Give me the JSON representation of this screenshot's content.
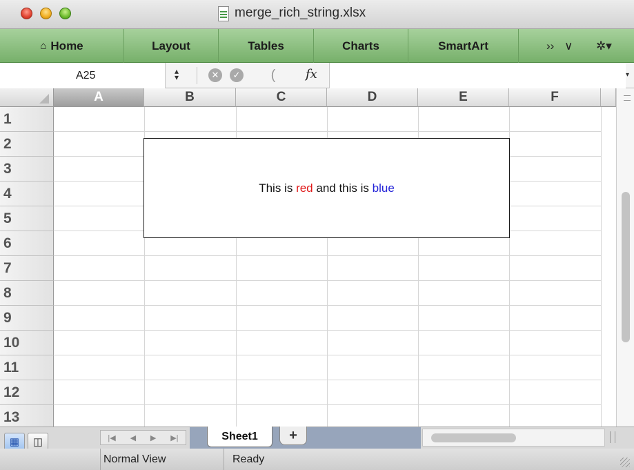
{
  "window": {
    "title": "merge_rich_string.xlsx"
  },
  "ribbon": {
    "tabs": [
      "Home",
      "Layout",
      "Tables",
      "Charts",
      "SmartArt"
    ],
    "more": "››",
    "collapse": "∨",
    "settings": "✲▾"
  },
  "formula_bar": {
    "name_box": "A25",
    "fx_label": "fx",
    "value": ""
  },
  "grid": {
    "columns": [
      "A",
      "B",
      "C",
      "D",
      "E",
      "F"
    ],
    "selected_column": "A",
    "rows": [
      "1",
      "2",
      "3",
      "4",
      "5",
      "6",
      "7",
      "8",
      "9",
      "10",
      "11",
      "12",
      "13"
    ]
  },
  "textbox": {
    "run1": "This is ",
    "run2": "red",
    "run3": " and this is ",
    "run4": "blue",
    "colors": {
      "red": "#e01a1a",
      "blue": "#2323d8"
    }
  },
  "sheets": {
    "tabs": [
      "Sheet1"
    ],
    "add_label": "+"
  },
  "status": {
    "view": "Normal View",
    "state": "Ready"
  },
  "theme": {
    "ribbon_green": "#8cc27f"
  }
}
